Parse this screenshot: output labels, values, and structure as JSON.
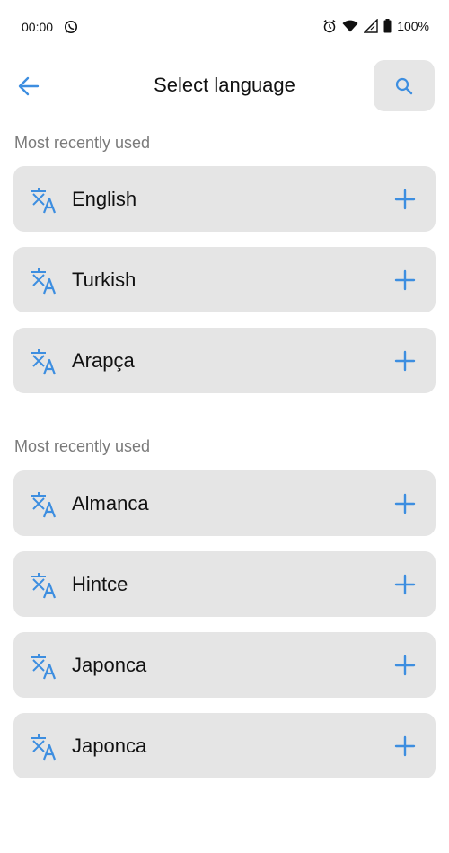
{
  "status_bar": {
    "time": "00:00",
    "battery_text": "100%"
  },
  "header": {
    "title": "Select language"
  },
  "sections": [
    {
      "title": "Most recently used",
      "items": [
        {
          "label": "English"
        },
        {
          "label": "Turkish"
        },
        {
          "label": "Arapça"
        }
      ]
    },
    {
      "title": "Most recently used",
      "items": [
        {
          "label": "Almanca"
        },
        {
          "label": "Hintce"
        },
        {
          "label": "Japonca"
        },
        {
          "label": "Japonca"
        }
      ]
    }
  ],
  "icons": {
    "back": "arrow-left-icon",
    "search": "search-icon",
    "language": "translate-icon",
    "add": "plus-icon",
    "whatsapp": "whatsapp-icon",
    "alarm": "alarm-icon",
    "wifi": "wifi-icon",
    "signal": "signal-icon",
    "battery": "battery-icon"
  },
  "colors": {
    "accent": "#3d8ee0",
    "card_background": "#e5e5e5",
    "section_header": "#7a7a7a"
  }
}
